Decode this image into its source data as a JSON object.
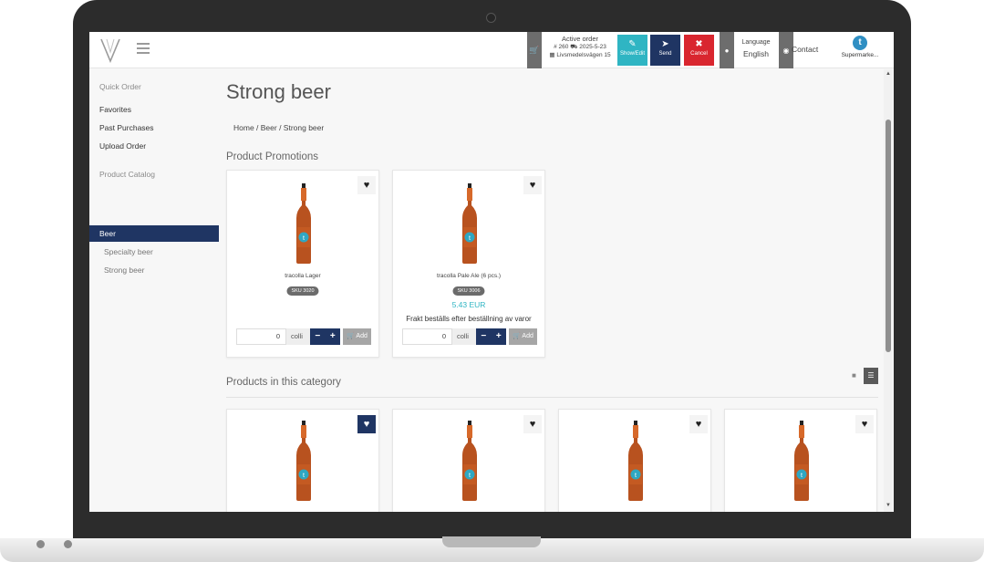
{
  "topbar": {
    "active_order": {
      "title": "Active order",
      "number": "# 260",
      "date": "2025-5-23",
      "address": "Livsmedelsvägen 15"
    },
    "buttons": {
      "show_edit": "Show/Edit",
      "send": "Send",
      "cancel": "Cancel"
    },
    "language": {
      "label": "Language",
      "value": "English"
    },
    "contact": "Contact",
    "customer": "Supermarke..."
  },
  "sidebar": {
    "quick_order": "Quick Order",
    "items": [
      "Favorites",
      "Past Purchases",
      "Upload Order"
    ],
    "catalog_heading": "Product Catalog",
    "active": "Beer",
    "sub_items": [
      "Specialty beer",
      "Strong beer"
    ]
  },
  "main": {
    "title": "Strong beer",
    "breadcrumb": "Home  /  Beer  /  Strong beer",
    "promotions_title": "Product Promotions",
    "category_title": "Products in this category",
    "promotions": [
      {
        "name": "tracolla Lager",
        "sku": "SKU 3020",
        "price": "",
        "note": "",
        "qty": "0",
        "unit": "colli",
        "add": "Add"
      },
      {
        "name": "tracolla Pale Ale (6 pcs.)",
        "sku": "SKU 3006",
        "price": "5.43 EUR",
        "note": "Frakt beställs efter beställning av varor",
        "qty": "0",
        "unit": "colli",
        "add": "Add"
      }
    ]
  },
  "colors": {
    "navy": "#1f3563",
    "teal": "#2fb5c3",
    "red": "#d9262f",
    "bottle_amber": "#b8521f"
  },
  "icons": {
    "cart": "cart-icon",
    "edit": "edit-icon",
    "send": "paper-plane-icon",
    "cancel": "cancel-icon",
    "heart": "heart-icon",
    "globe": "globe-icon"
  }
}
